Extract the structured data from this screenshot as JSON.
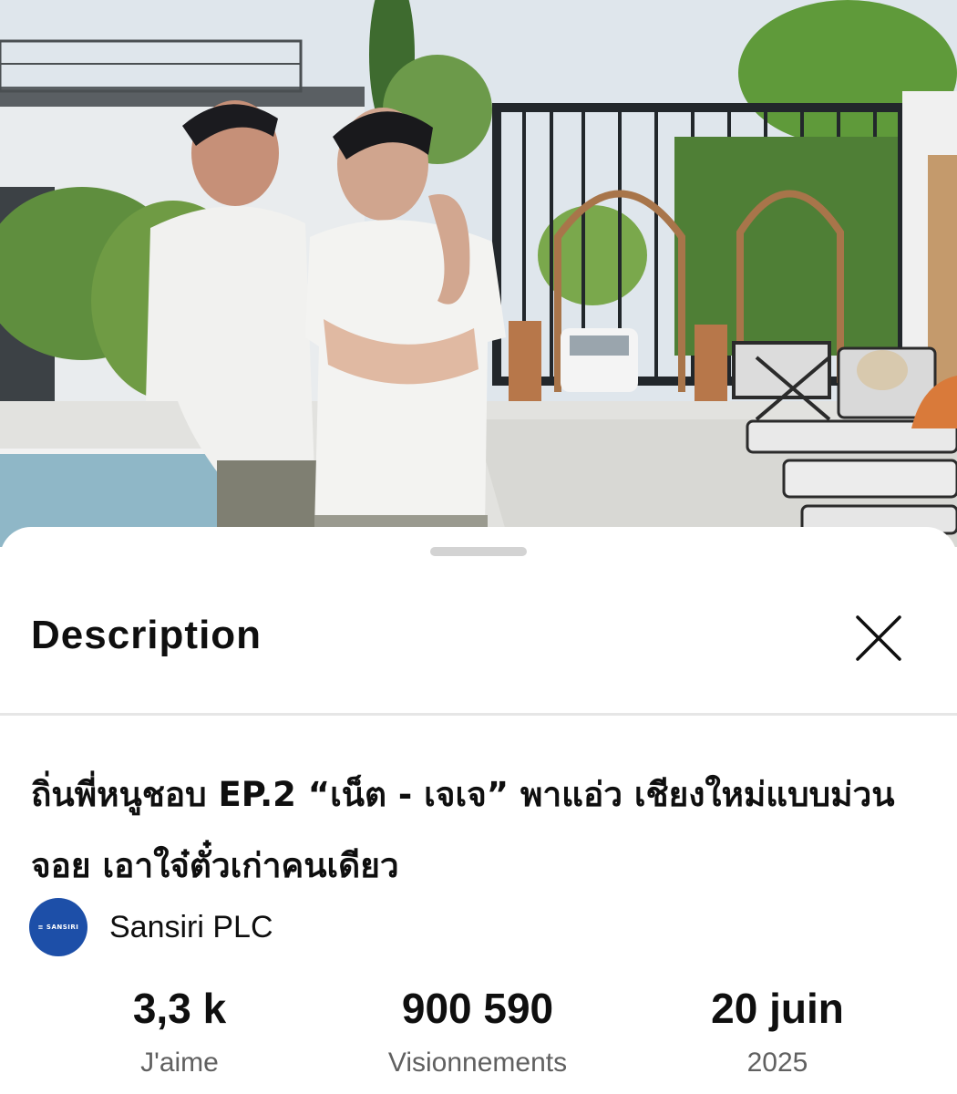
{
  "video": {
    "thumbnail_icon": "video-frame"
  },
  "sheet": {
    "title": "Description",
    "close_icon": "close-icon"
  },
  "video_info": {
    "title": "ถิ่นพี่หนูชอบ EP.2 “เน็ต - เจเจ” พาแอ่ว เชียงใหม่แบบม่วนจอย เอาใจ๋ตั๋วเก่าคนเดียว",
    "channel": {
      "name": "Sansiri PLC",
      "avatar_text": "≡ SANSIRI",
      "avatar_color": "#1d4fa8"
    }
  },
  "stats": {
    "likes": {
      "value": "3,3 k",
      "label": "J'aime"
    },
    "views": {
      "value": "900 590",
      "label": "Visionnements"
    },
    "date": {
      "value": "20 juin",
      "label": "2025"
    }
  }
}
